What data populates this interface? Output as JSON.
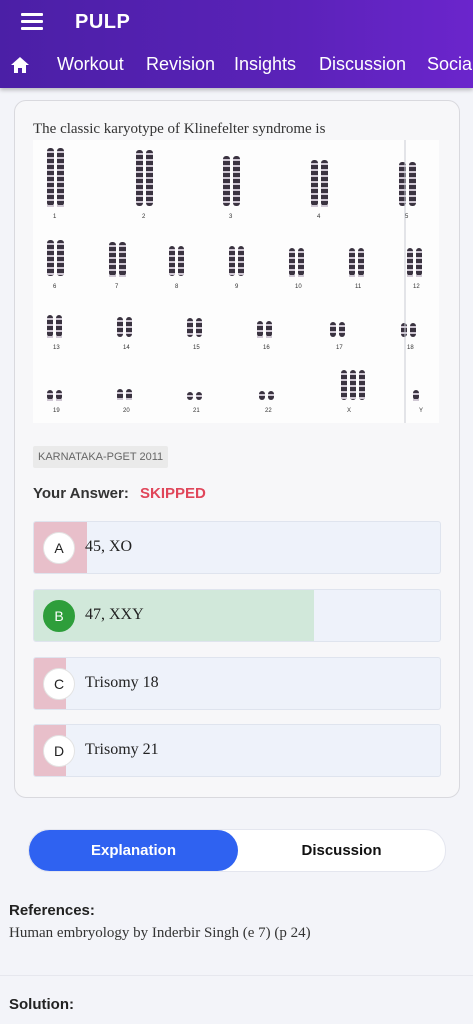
{
  "app": {
    "title": "PULP"
  },
  "nav": {
    "items": [
      "Workout",
      "Revision",
      "Insights",
      "Discussion",
      "Social"
    ]
  },
  "question": {
    "text": "The classic karyotype of Klinefelter syndrome is",
    "tag": "KARNATAKA-PGET 2011",
    "your_answer_label": "Your Answer:",
    "your_answer_value": "SKIPPED",
    "options": [
      {
        "letter": "A",
        "text": "45, XO",
        "percent": 13,
        "correct": false
      },
      {
        "letter": "B",
        "text": "47, XXY",
        "percent": 69,
        "correct": true
      },
      {
        "letter": "C",
        "text": "Trisomy 18",
        "percent": 8,
        "correct": false
      },
      {
        "letter": "D",
        "text": "Trisomy 21",
        "percent": 8,
        "correct": false
      }
    ]
  },
  "karyotype": {
    "labels": [
      "1",
      "2",
      "3",
      "4",
      "5",
      "6",
      "7",
      "8",
      "9",
      "10",
      "11",
      "12",
      "13",
      "14",
      "15",
      "16",
      "17",
      "18",
      "19",
      "20",
      "21",
      "22",
      "X",
      "Y"
    ]
  },
  "tabs": {
    "explanation": "Explanation",
    "discussion": "Discussion"
  },
  "references": {
    "heading": "References:",
    "text": "Human embryology by Inderbir Singh (e 7) (p 24)"
  },
  "solution": {
    "heading": "Solution:"
  },
  "colors": {
    "header": "#5a22b8",
    "correct": "#d1e8da",
    "wrong": "#e8bfca",
    "accent": "#2f62f1",
    "skipped": "#e0465a"
  }
}
